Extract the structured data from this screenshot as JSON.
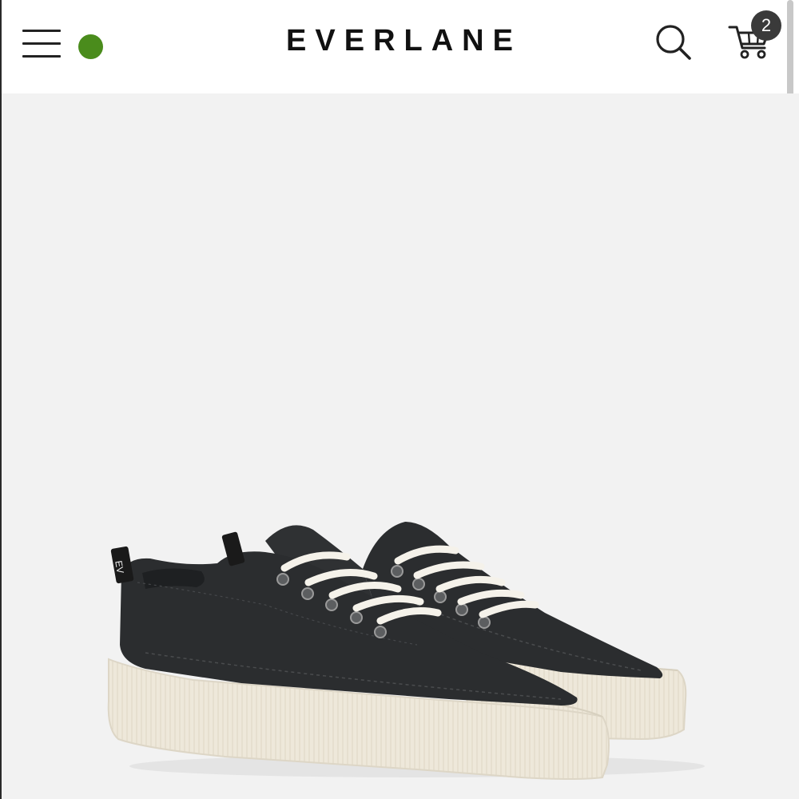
{
  "header": {
    "brand": "EVERLANE",
    "cart_count": "2",
    "status_dot_color": "#4a8c1c",
    "icons": [
      "menu-icon",
      "search-icon",
      "cart-icon"
    ]
  },
  "hero": {
    "image": "product-sneaker-photo",
    "heel_tab_text": "EV"
  },
  "colors": {
    "canvas": "#2b2d2f",
    "sole": "#efe9dc",
    "laces": "#f5f2ea",
    "background": "#f2f2f2"
  }
}
